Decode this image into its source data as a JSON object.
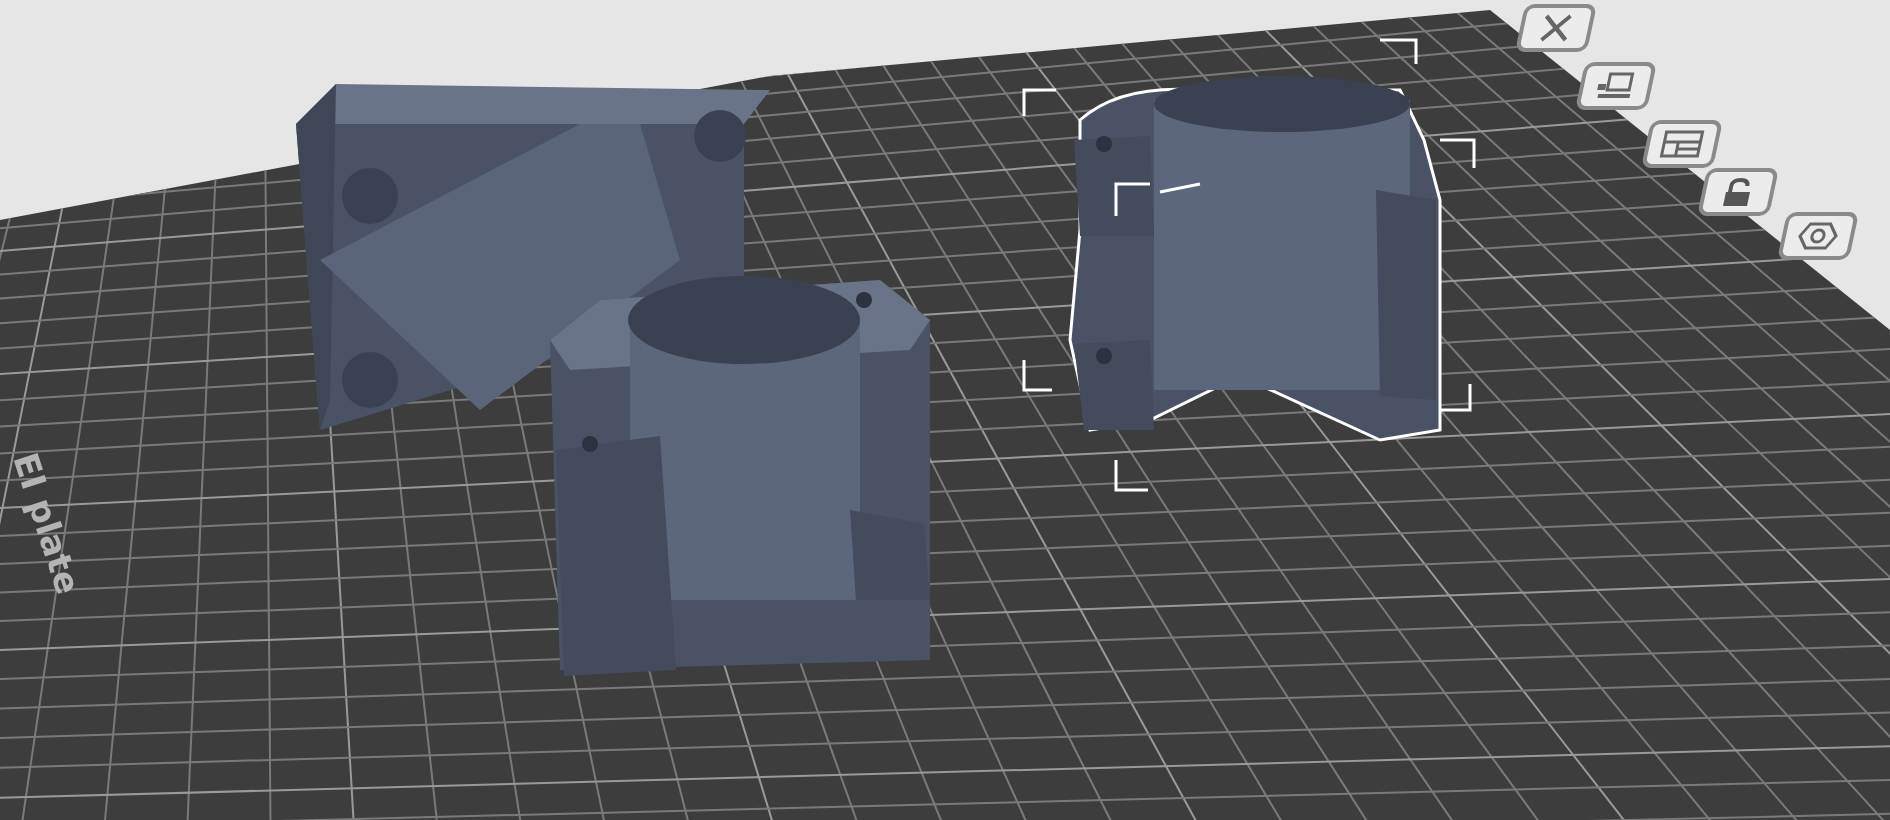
{
  "plate": {
    "label": "EI plate"
  },
  "models": [
    {
      "kind": "bracket",
      "selected": false
    },
    {
      "kind": "clamp",
      "selected": true
    }
  ],
  "toolbar": [
    {
      "kind": "delete"
    },
    {
      "kind": "arrange"
    },
    {
      "kind": "layout"
    },
    {
      "kind": "lock"
    },
    {
      "kind": "settings"
    }
  ]
}
